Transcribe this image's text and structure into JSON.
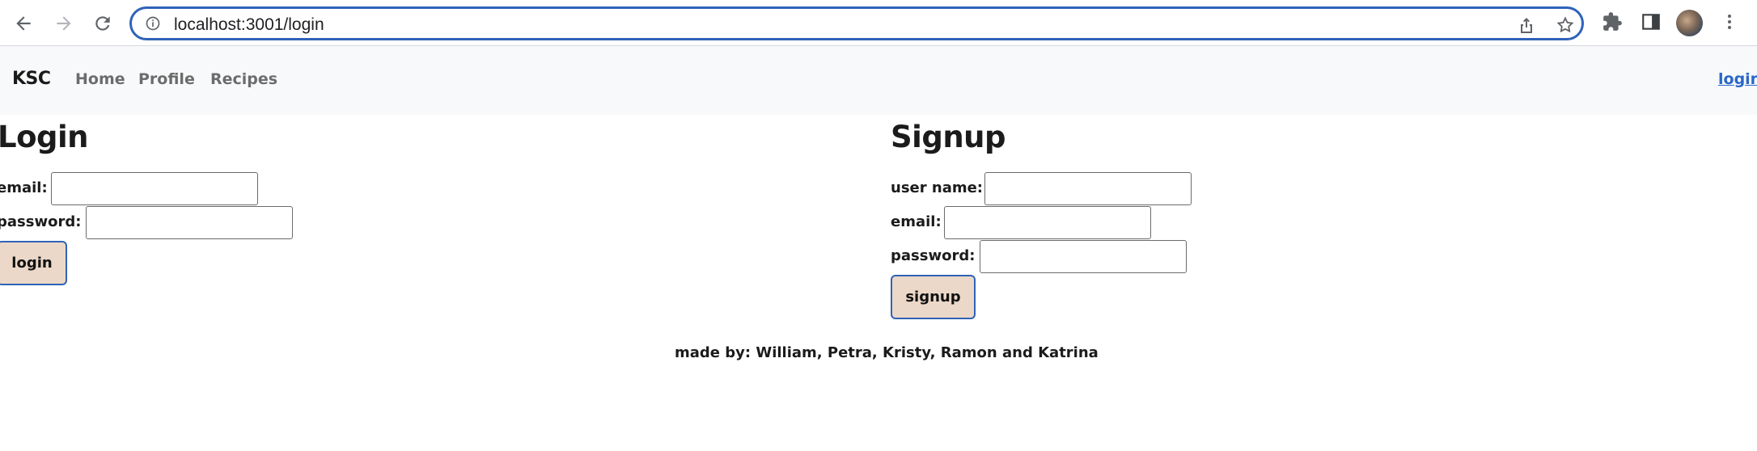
{
  "browser": {
    "url": "localhost:3001/login",
    "icons": {
      "back": "arrow-left-icon",
      "forward": "arrow-right-icon",
      "reload": "reload-icon",
      "info": "info-icon",
      "share": "share-icon",
      "star": "star-icon",
      "extensions": "puzzle-icon",
      "sidepanel": "sidepanel-icon",
      "avatar": "avatar",
      "menu": "kebab-menu-icon"
    },
    "accent_color": "#2f63b8"
  },
  "nav": {
    "brand": "KSC",
    "links": [
      "Home",
      "Profile",
      "Recipes"
    ],
    "login_link": "login",
    "background": "#f8f9fa",
    "link_color": "#6c6c6c",
    "login_color": "#2a67c9"
  },
  "login_form": {
    "title": "Login",
    "email_label": "email:",
    "email_value": "",
    "password_label": "password:",
    "password_value": "",
    "button_label": "login"
  },
  "signup_form": {
    "title": "Signup",
    "username_label": "user name:",
    "username_value": "",
    "email_label": "email:",
    "email_value": "",
    "password_label": "password:",
    "password_value": "",
    "button_label": "signup"
  },
  "button_colors": {
    "fill": "#ecd8c8",
    "border": "#2f63b8"
  },
  "footer": {
    "text": "made by: William, Petra, Kristy, Ramon and Katrina"
  }
}
